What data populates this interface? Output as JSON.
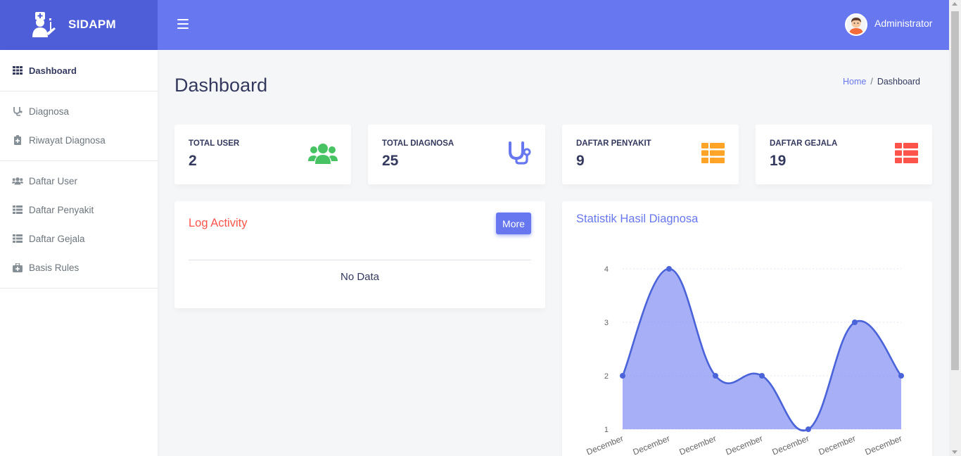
{
  "brand": {
    "name": "SIDAPM",
    "icon": "doctor-icon"
  },
  "header": {
    "menu_icon": "hamburger-icon",
    "user_name": "Administrator"
  },
  "sidebar": {
    "items": [
      {
        "label": "Dashboard",
        "icon": "grid-icon",
        "active": true
      },
      {
        "label": "Diagnosa",
        "icon": "stethoscope-icon"
      },
      {
        "label": "Riwayat Diagnosa",
        "icon": "clipboard-icon"
      },
      {
        "label": "Daftar User",
        "icon": "users-icon"
      },
      {
        "label": "Daftar Penyakit",
        "icon": "table-icon"
      },
      {
        "label": "Daftar Gejala",
        "icon": "table-icon"
      },
      {
        "label": "Basis Rules",
        "icon": "medkit-icon"
      }
    ]
  },
  "page": {
    "title": "Dashboard",
    "breadcrumb": {
      "home": "Home",
      "separator": "/",
      "current": "Dashboard"
    }
  },
  "stats": [
    {
      "title": "TOTAL USER",
      "value": "2",
      "icon": "users-icon",
      "color": "#47c363"
    },
    {
      "title": "TOTAL DIAGNOSA",
      "value": "25",
      "icon": "stethoscope-icon",
      "color": "#6777ef"
    },
    {
      "title": "DAFTAR PENYAKIT",
      "value": "9",
      "icon": "table-icon",
      "color": "#ffa426"
    },
    {
      "title": "DAFTAR GEJALA",
      "value": "19",
      "icon": "table-icon",
      "color": "#fc544b"
    }
  ],
  "log_activity": {
    "title": "Log Activity",
    "more_label": "More",
    "empty_text": "No Data"
  },
  "chart_data": {
    "type": "area",
    "title": "Statistik Hasil Diagnosa",
    "x": [
      "December",
      "December",
      "December",
      "December",
      "December",
      "December",
      "December"
    ],
    "x_prefixes": [
      "",
      "",
      "",
      "",
      "",
      "",
      ""
    ],
    "series": [
      {
        "values": [
          2,
          4,
          2,
          2,
          1,
          3,
          2
        ],
        "color": "#6777ef"
      }
    ],
    "yticks": [
      1,
      2,
      3,
      4
    ],
    "ylim": [
      1,
      4
    ],
    "grid": true,
    "smooth": true
  },
  "colors": {
    "primary": "#6777ef",
    "brand_dark": "#4e5dd8",
    "danger": "#fc544b",
    "success": "#47c363",
    "warning": "#ffa426"
  }
}
